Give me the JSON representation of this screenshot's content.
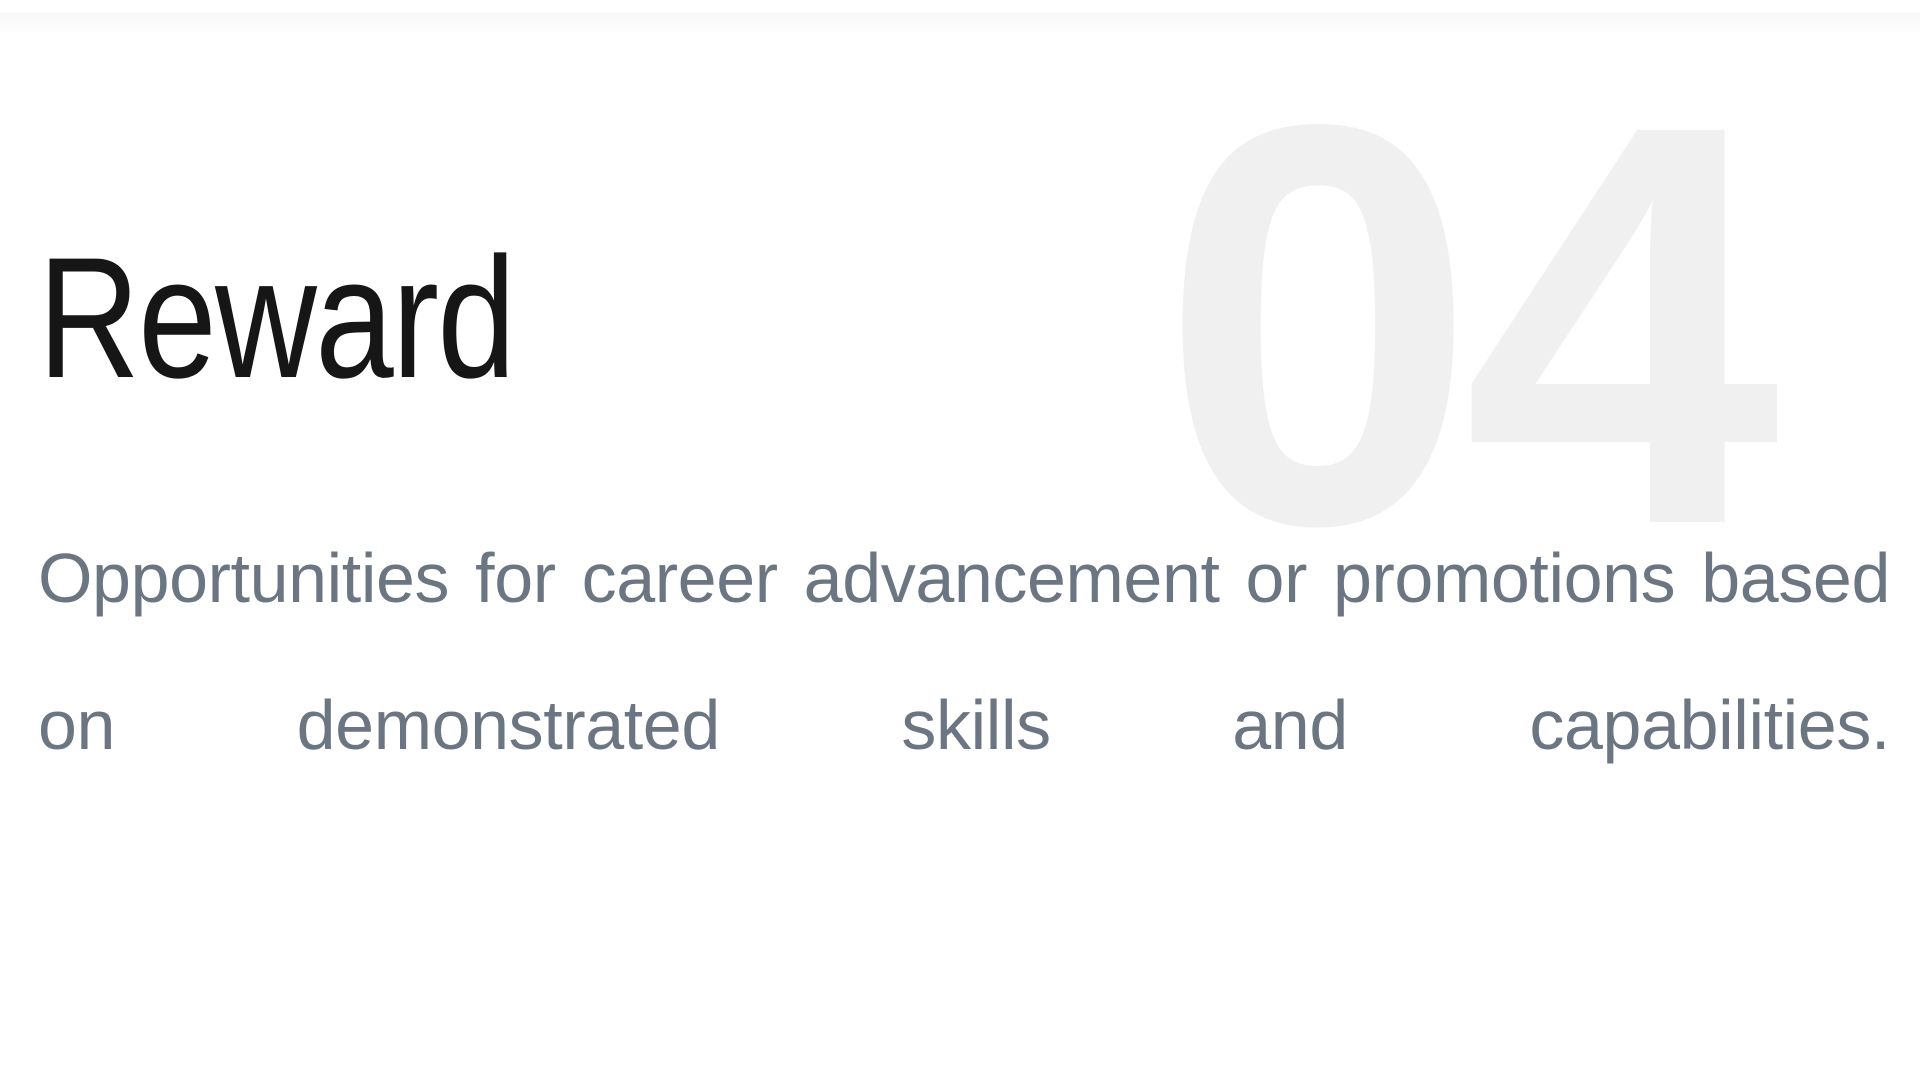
{
  "slide": {
    "background_color": "#ffffff",
    "top_divider_color": "#fafafb",
    "step_number": "04",
    "step_number_color": "#f0f0f1",
    "heading": "Reward",
    "heading_color": "#161616",
    "description": "Opportunities for career advancement or promotions based on demonstrated skills and capabilities.",
    "description_color": "#6b7682"
  }
}
